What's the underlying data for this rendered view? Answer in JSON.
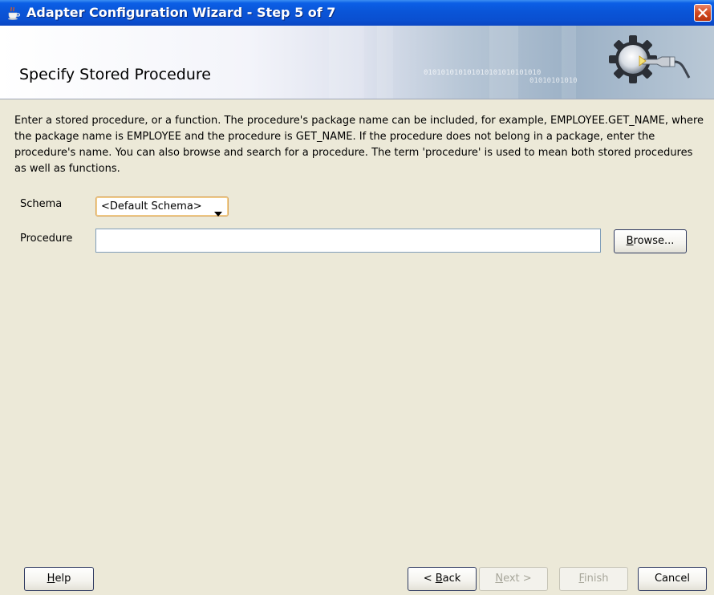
{
  "window": {
    "title": "Adapter Configuration Wizard - Step 5 of 7",
    "icons": {
      "app": "java-cup-icon",
      "close": "close-icon"
    }
  },
  "header": {
    "title": "Specify Stored Procedure",
    "binary_text_1": "010101010101010101010101010",
    "binary_text_2": "01010101010"
  },
  "description": "Enter a stored procedure, or a function. The procedure's package name can be included, for example, EMPLOYEE.GET_NAME, where the package name is EMPLOYEE and the procedure is GET_NAME.  If the procedure does not belong in a package, enter the procedure's name. You can also browse and search for a procedure. The term 'procedure' is used to mean both stored procedures as well as functions.",
  "form": {
    "schema_label": "Schema",
    "schema_value": "<Default Schema>",
    "procedure_label": "Procedure",
    "procedure_value": "",
    "browse": {
      "mnemonic": "B",
      "rest": "rowse..."
    }
  },
  "footer": {
    "help": {
      "mnemonic": "H",
      "rest": "elp"
    },
    "back": {
      "prefix": "< ",
      "mnemonic": "B",
      "rest": "ack"
    },
    "next": {
      "mnemonic": "N",
      "rest": "ext >"
    },
    "finish": {
      "mnemonic": "F",
      "rest": "inish"
    },
    "cancel": "Cancel"
  },
  "colors": {
    "titlebar": "#0a55d8",
    "dialog_bg": "#ece9d8",
    "select_border": "#d9a25a",
    "input_border": "#7f9db9"
  }
}
